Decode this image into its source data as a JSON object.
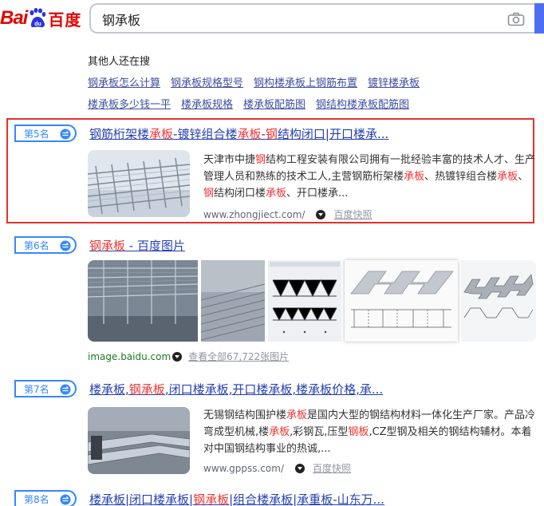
{
  "header": {
    "logo_latin": "Bai",
    "logo_du": "du",
    "logo_cn": "百度",
    "search_value": "钢承板"
  },
  "related": {
    "title": "其他人还在搜",
    "row1": [
      "钢承板怎么计算",
      "钢承板规格型号",
      "钢构楼承板上钢筋布置",
      "镀锌楼承板"
    ],
    "row2": [
      "楼承板多少钱一平",
      "楼承板规格",
      "楼承板配筋图",
      "钢结构楼承板配筋图"
    ]
  },
  "results": [
    {
      "rank": "第5名",
      "title_parts": [
        {
          "t": "钢筋桁架楼",
          "red": false
        },
        {
          "t": "承板",
          "red": true
        },
        {
          "t": "-镀锌组合楼",
          "red": false
        },
        {
          "t": "承板",
          "red": true
        },
        {
          "t": "-",
          "red": false
        },
        {
          "t": "钢",
          "red": true
        },
        {
          "t": "结构闭口|开口楼承...",
          "red": false
        }
      ],
      "abstract_parts": [
        {
          "t": "天津市中捷",
          "red": false
        },
        {
          "t": "钢",
          "red": true
        },
        {
          "t": "结构工程安装有限公司拥有一批经验丰富的技术人才、生产管理人员和熟练的技术工人,主营钢筋桁架楼",
          "red": false
        },
        {
          "t": "承板",
          "red": true
        },
        {
          "t": "、热镀锌组合楼",
          "red": false
        },
        {
          "t": "承板",
          "red": true
        },
        {
          "t": "、",
          "red": false
        },
        {
          "t": "钢",
          "red": true
        },
        {
          "t": "结构闭口楼",
          "red": false
        },
        {
          "t": "承板",
          "red": true
        },
        {
          "t": "、开口楼承...",
          "red": false
        }
      ],
      "source": "www.zhongjiect.com/",
      "snapshot": "百度快照"
    },
    {
      "rank": "第6名",
      "title_parts": [
        {
          "t": "钢承板",
          "red": true
        },
        {
          "t": " - 百度图片",
          "red": false
        }
      ],
      "source": "image.baidu.com",
      "view_all": "查看全部67,722张图片"
    },
    {
      "rank": "第7名",
      "title_parts": [
        {
          "t": "楼承板,",
          "red": false
        },
        {
          "t": "钢承板",
          "red": true
        },
        {
          "t": ",闭口楼承板,开口楼承板,楼承板价格,承...",
          "red": false
        }
      ],
      "abstract_parts": [
        {
          "t": "无锡钢结构围护楼",
          "red": false
        },
        {
          "t": "承板",
          "red": true
        },
        {
          "t": "是国内大型的钢结构材料一体化生产厂家。产品冷弯成型机械,楼",
          "red": false
        },
        {
          "t": "承板",
          "red": true
        },
        {
          "t": ",彩钢瓦,压型",
          "red": false
        },
        {
          "t": "钢板",
          "red": true
        },
        {
          "t": ",CZ型钢及相关的钢结构辅材。本着对中国钢结构事业的热诚,...",
          "red": false
        }
      ],
      "source": "www.gppss.com/",
      "snapshot": "百度快照"
    },
    {
      "rank": "第8名",
      "title_parts": [
        {
          "t": "楼承板|闭口楼承板|",
          "red": false
        },
        {
          "t": "钢承板",
          "red": true
        },
        {
          "t": "|组合楼承板|承重板-山东万...",
          "red": false
        }
      ]
    }
  ],
  "colors": {
    "link": "#2440b3",
    "highlight": "#f73131",
    "rank_blue": "#3388ff",
    "frame_red": "#e5322d"
  }
}
